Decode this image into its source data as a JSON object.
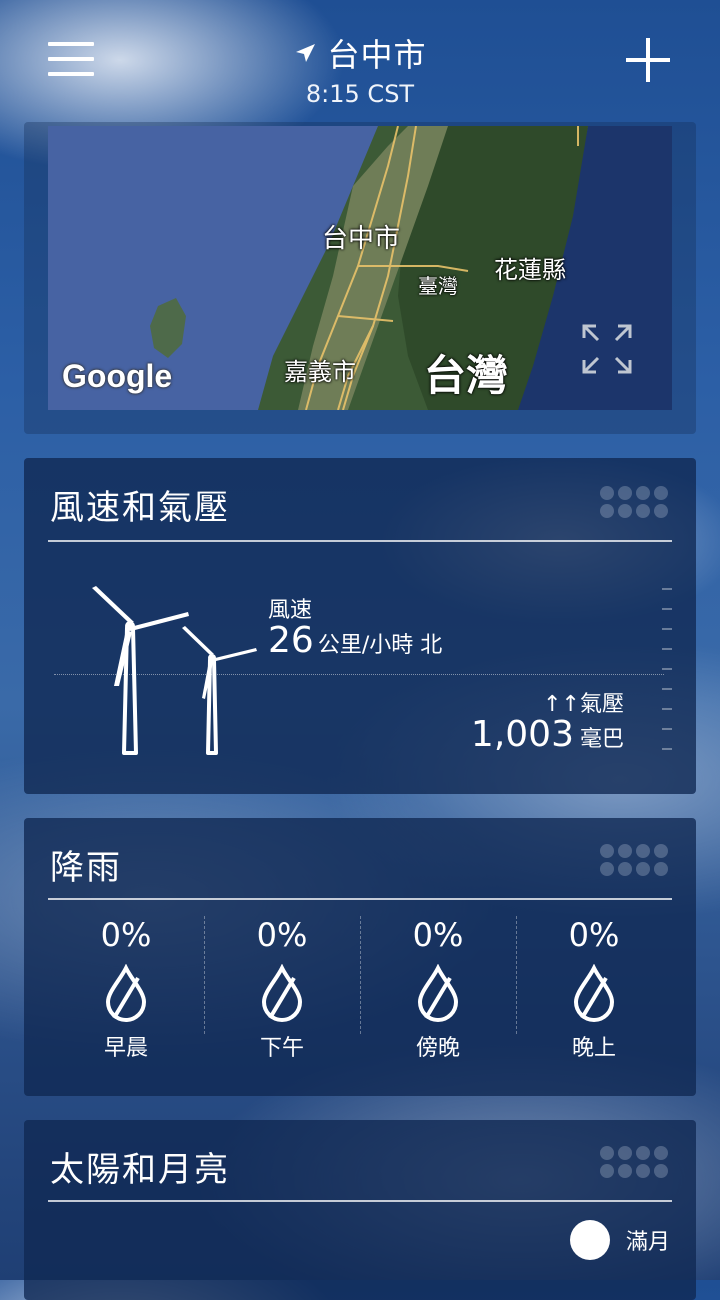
{
  "header": {
    "city": "台中市",
    "time": "8:15 CST"
  },
  "map": {
    "labels": {
      "taichung": "台中市",
      "taiwan_small": "臺灣",
      "hualien": "花蓮縣",
      "chiayi": "嘉義市",
      "taiwan_big": "台灣"
    },
    "attribution": "Google"
  },
  "wind": {
    "title": "風速和氣壓",
    "speed_label": "風速",
    "speed_value": "26",
    "speed_unit": "公里/小時 北",
    "pressure_label": "↑↑氣壓",
    "pressure_value": "1,003",
    "pressure_unit": "毫巴"
  },
  "rain": {
    "title": "降雨",
    "periods": [
      {
        "pct": "0%",
        "label": "早晨"
      },
      {
        "pct": "0%",
        "label": "下午"
      },
      {
        "pct": "0%",
        "label": "傍晚"
      },
      {
        "pct": "0%",
        "label": "晚上"
      }
    ]
  },
  "sun_moon": {
    "title": "太陽和月亮",
    "moon_phase": "滿月"
  }
}
